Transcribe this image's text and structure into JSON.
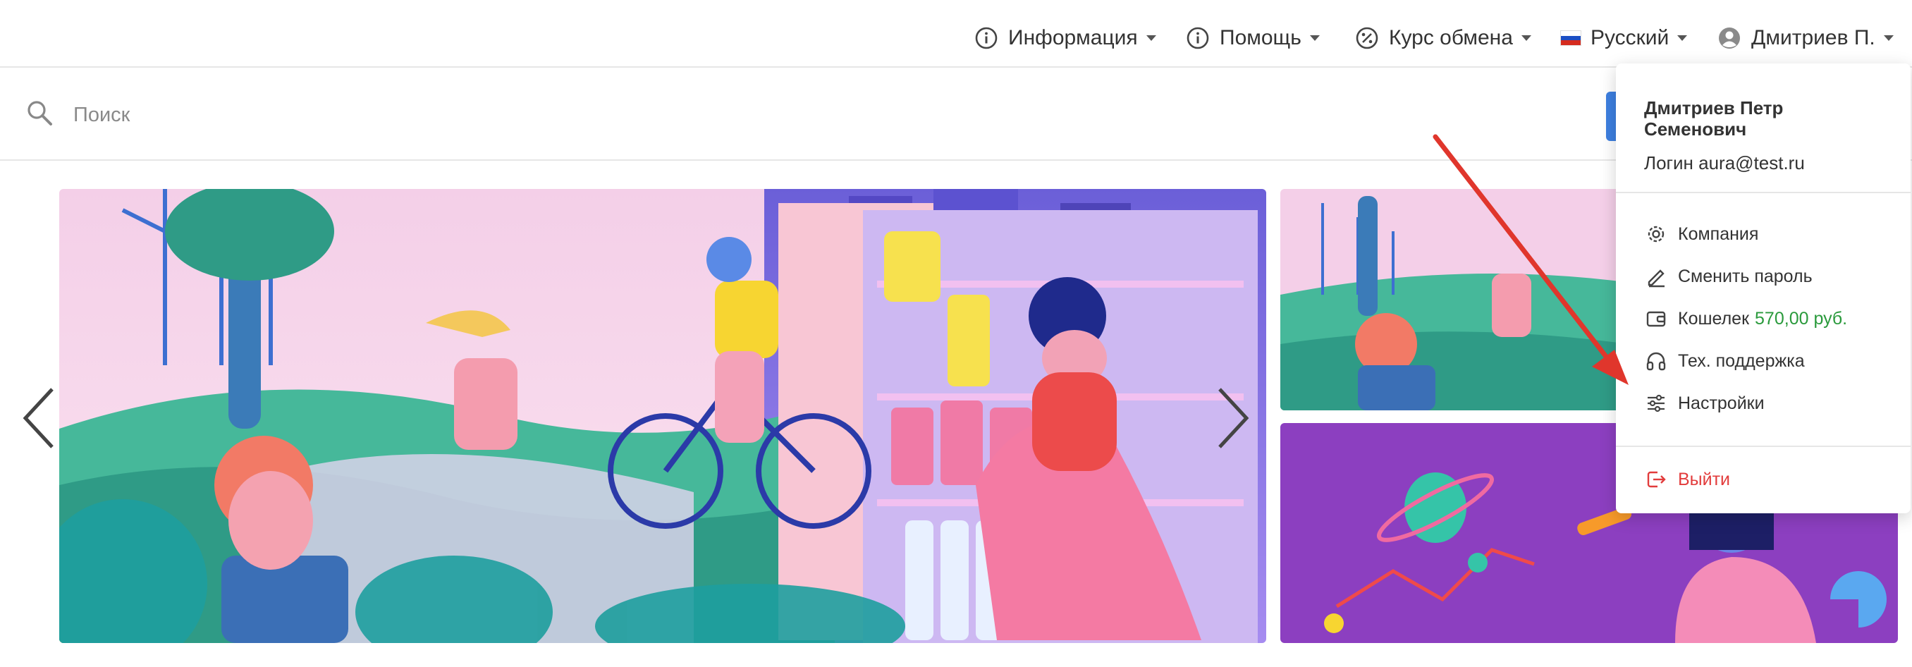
{
  "nav": {
    "info_label": "Информация",
    "help_label": "Помощь",
    "exchange_label": "Курс обмена",
    "language_label": "Русский",
    "user_label": "Дмитриев П."
  },
  "search": {
    "placeholder": "Поиск"
  },
  "user_menu": {
    "full_name": "Дмитриев Петр Семенович",
    "login_text": "Логин aura@test.ru",
    "items": {
      "company": "Компания",
      "change_password": "Сменить пароль",
      "wallet": "Кошелек",
      "wallet_amount": "570,00 руб.",
      "support": "Тех. поддержка",
      "settings": "Настройки",
      "logout": "Выйти"
    }
  },
  "colors": {
    "accent": "#3d7fe0",
    "wallet_amount": "#2a9a3c",
    "logout": "#e23c3c",
    "annotation_arrow": "#e0362c",
    "banner_purple": "#8c3fc0"
  },
  "icons": {
    "info": "info-circle-icon",
    "help": "info-circle-icon",
    "exchange": "percent-circle-icon",
    "language": "russian-flag-icon",
    "user": "user-circle-icon",
    "search": "search-icon",
    "company": "gear-icon",
    "change_password": "pencil-icon",
    "wallet": "wallet-icon",
    "support": "headphones-icon",
    "settings": "sliders-icon",
    "logout": "logout-icon"
  }
}
